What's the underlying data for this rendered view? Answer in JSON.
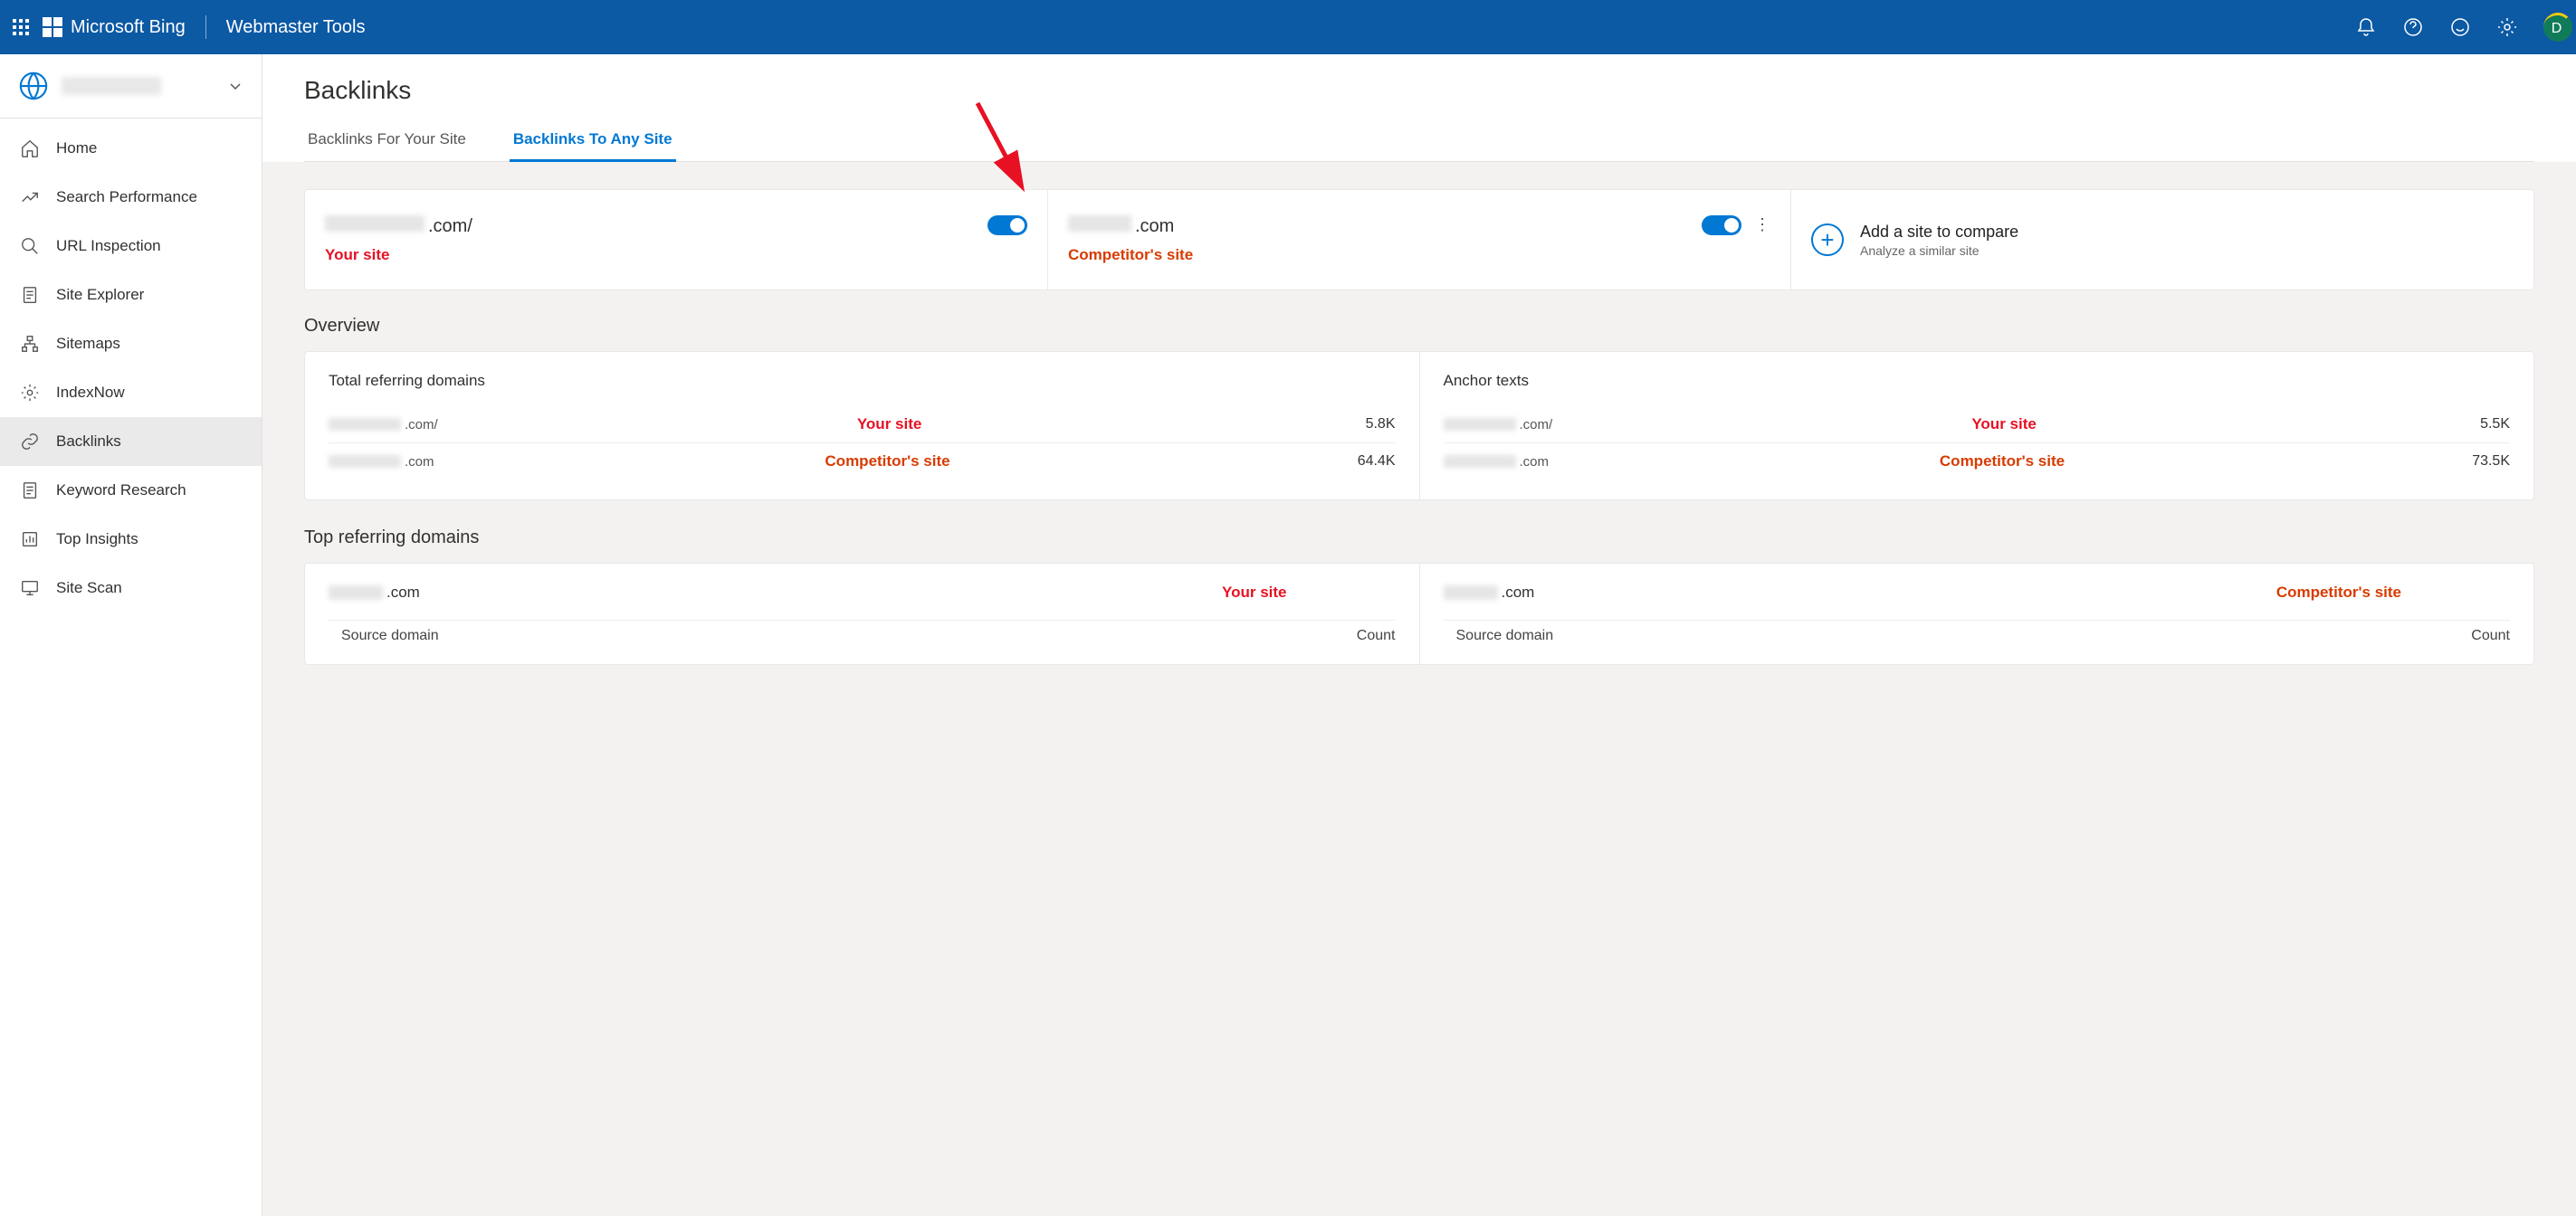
{
  "header": {
    "brand1": "Microsoft Bing",
    "brand2": "Webmaster Tools",
    "avatar_letter": "D"
  },
  "sidebar": {
    "site_blurred": true,
    "items": [
      {
        "icon": "home",
        "label": "Home"
      },
      {
        "icon": "trend",
        "label": "Search Performance"
      },
      {
        "icon": "search",
        "label": "URL Inspection"
      },
      {
        "icon": "doc",
        "label": "Site Explorer"
      },
      {
        "icon": "tree",
        "label": "Sitemaps"
      },
      {
        "icon": "gear",
        "label": "IndexNow"
      },
      {
        "icon": "link",
        "label": "Backlinks",
        "active": true
      },
      {
        "icon": "doc",
        "label": "Keyword Research"
      },
      {
        "icon": "insight",
        "label": "Top Insights"
      },
      {
        "icon": "desktop",
        "label": "Site Scan"
      }
    ]
  },
  "page": {
    "title": "Backlinks",
    "tabs": [
      {
        "label": "Backlinks For Your Site",
        "active": false
      },
      {
        "label": "Backlinks To Any Site",
        "active": true
      }
    ]
  },
  "sites": {
    "your": {
      "domain_suffix": ".com/",
      "tag": "Your site"
    },
    "competitor": {
      "domain_suffix": ".com",
      "tag": "Competitor's site"
    },
    "add": {
      "title": "Add a site to compare",
      "subtitle": "Analyze a similar site"
    }
  },
  "overview": {
    "title": "Overview",
    "cards": {
      "referring": {
        "title": "Total referring domains",
        "rows": [
          {
            "suffix": ".com/",
            "tag": "Your site",
            "tag_class": "red",
            "value": "5.8K"
          },
          {
            "suffix": ".com",
            "tag": "Competitor's site",
            "tag_class": "orange",
            "value": "64.4K"
          }
        ]
      },
      "anchor": {
        "title": "Anchor texts",
        "rows": [
          {
            "suffix": ".com/",
            "tag": "Your site",
            "tag_class": "red",
            "value": "5.5K"
          },
          {
            "suffix": ".com",
            "tag": "Competitor's site",
            "tag_class": "orange",
            "value": "73.5K"
          }
        ]
      }
    }
  },
  "top": {
    "title": "Top referring domains",
    "cols": [
      {
        "suffix": ".com",
        "tag": "Your site",
        "tag_class": "red",
        "h1": "Source domain",
        "h2": "Count"
      },
      {
        "suffix": ".com",
        "tag": "Competitor's site",
        "tag_class": "orange",
        "h1": "Source domain",
        "h2": "Count"
      }
    ]
  }
}
